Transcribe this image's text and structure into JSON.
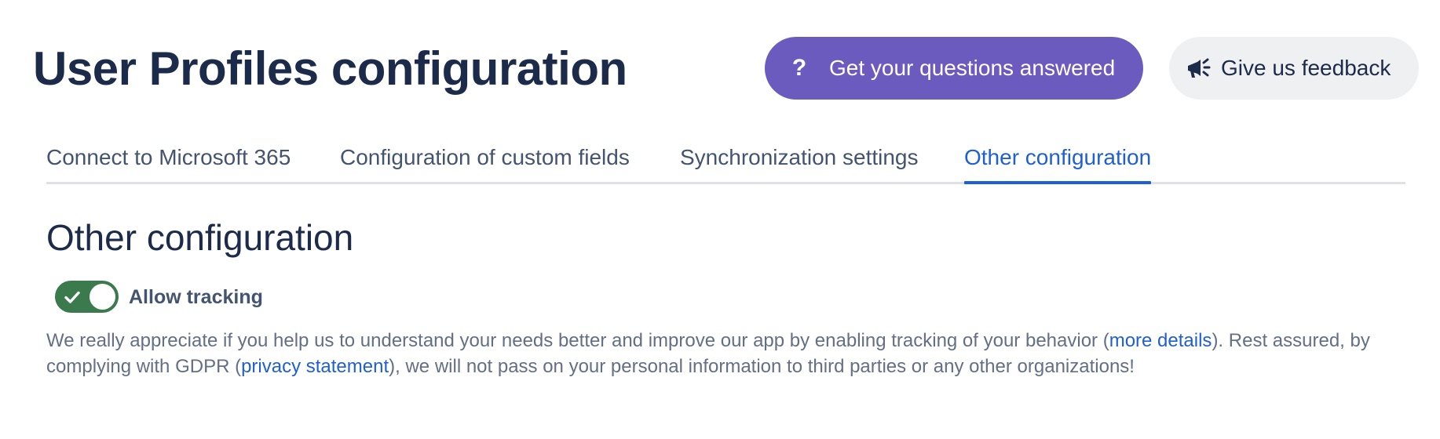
{
  "header": {
    "title": "User Profiles configuration",
    "questions_button": {
      "icon": "question-icon",
      "icon_glyph": "?",
      "label": "Get your questions answered",
      "color": "#6c5bbf"
    },
    "feedback_button": {
      "icon": "megaphone-icon",
      "label": "Give us feedback",
      "color": "#eff0f2"
    }
  },
  "tabs": [
    {
      "label": "Connect to Microsoft 365",
      "active": false
    },
    {
      "label": "Configuration of custom fields",
      "active": false
    },
    {
      "label": "Synchronization settings",
      "active": false
    },
    {
      "label": "Other configuration",
      "active": true
    }
  ],
  "colors": {
    "accent": "#1f5fd6",
    "toggle_on": "#3a7a4c",
    "heading": "#1c2b4a",
    "body_text": "#626f86"
  },
  "section": {
    "title": "Other configuration",
    "tracking_toggle": {
      "label": "Allow tracking",
      "checked": true,
      "icon": "check-icon"
    },
    "description": {
      "part1": "We really appreciate if you help us to understand your needs better and improve our app by enabling tracking of your behavior (",
      "link1": "more details",
      "part2": "). Rest assured, by complying with GDPR (",
      "link2": "privacy statement",
      "part3": "), we will not pass on your personal information to third parties or any other organizations!"
    }
  }
}
